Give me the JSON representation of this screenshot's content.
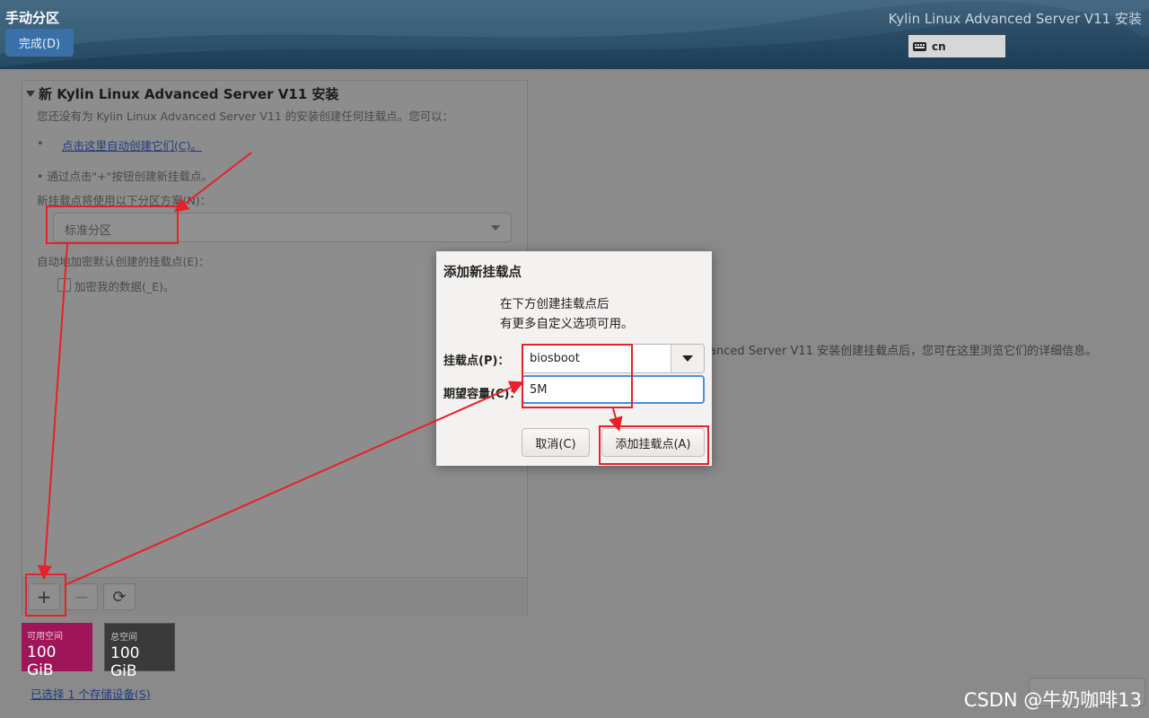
{
  "header": {
    "title": "手动分区",
    "done_label": "完成(D)",
    "product": "Kylin Linux Advanced Server V11 安装",
    "keyboard_layout": "cn"
  },
  "panel": {
    "install_title": "新 Kylin Linux Advanced Server V11 安装",
    "intro": "您还没有为 Kylin Linux Advanced Server V11 的安装创建任何挂载点。您可以：",
    "bullet1": "•",
    "auto_link": "点击这里自动创建它们(C)。",
    "manual_hint": "• 通过点击\"+\"按钮创建新挂载点。",
    "scheme_label": "新挂载点将使用以下分区方案(N)：",
    "scheme_value": "标准分区",
    "encrypt_label": "自动地加密默认创建的挂载点(E)：",
    "encrypt_checkbox": "加密我的数据(_E)。",
    "add_icon": "+",
    "remove_icon": "−",
    "refresh_icon": "⟳"
  },
  "space": {
    "available_label": "可用空间",
    "available_value": "100 GiB",
    "total_label": "总空间",
    "total_value": "100 GiB",
    "available_color": "#a0145a",
    "total_color": "#3a3a3a"
  },
  "storage_link": "已选择 1 个存储设备(S)",
  "right_info": "anced Server V11 安装创建挂载点后，您可在这里浏览它们的详细信息。",
  "watermark": "CSDN @牛奶咖啡13",
  "dialog": {
    "title": "添加新挂载点",
    "desc_line1": "在下方创建挂载点后",
    "desc_line2": "有更多自定义选项可用。",
    "mount_label": "挂载点(P)：",
    "mount_value": "biosboot",
    "size_label": "期望容量(C)：",
    "size_value": "5M",
    "cancel_label": "取消(C)",
    "add_label": "添加挂载点(A)"
  },
  "annotation_color": "#e8202a"
}
